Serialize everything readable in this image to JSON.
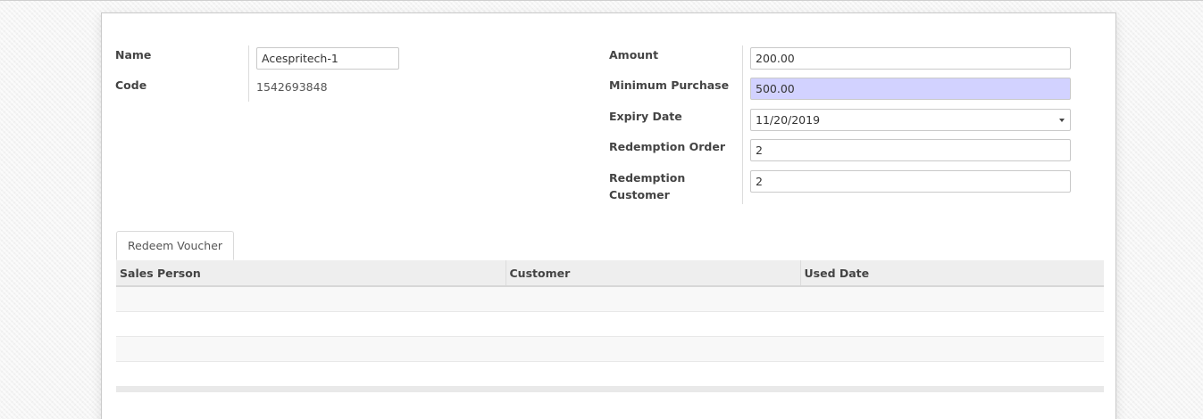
{
  "left_fields": {
    "name_label": "Name",
    "name_value": "Acespritech-1",
    "code_label": "Code",
    "code_value": "1542693848"
  },
  "right_fields": {
    "amount_label": "Amount",
    "amount_value": "200.00",
    "min_purchase_label": "Minimum Purchase",
    "min_purchase_value": "500.00",
    "expiry_label": "Expiry Date",
    "expiry_value": "11/20/2019",
    "redemption_order_label": "Redemption Order",
    "redemption_order_value": "2",
    "redemption_customer_label_line1": "Redemption",
    "redemption_customer_label_line2": "Customer",
    "redemption_customer_value": "2"
  },
  "tabs": [
    {
      "label": "Redeem Voucher"
    }
  ],
  "table": {
    "columns": [
      "Sales Person",
      "Customer",
      "Used Date"
    ],
    "rows": [
      [
        "",
        "",
        ""
      ],
      [
        "",
        "",
        ""
      ],
      [
        "",
        "",
        ""
      ],
      [
        "",
        "",
        ""
      ]
    ]
  },
  "colors": {
    "required_field": "#d2d2ff"
  }
}
